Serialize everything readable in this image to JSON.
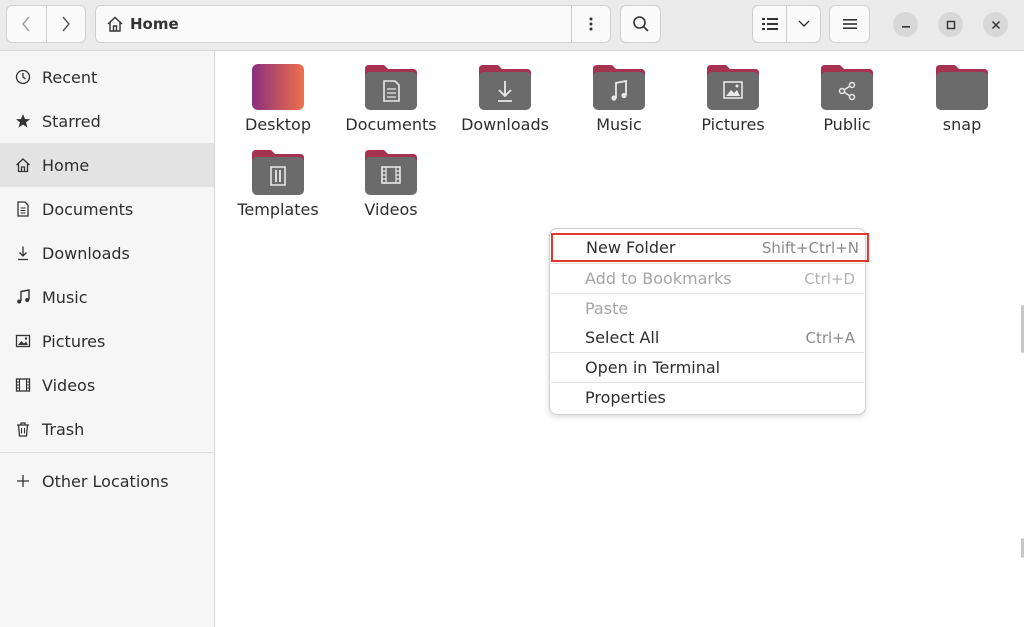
{
  "header": {
    "location": "Home"
  },
  "sidebar": {
    "items": [
      {
        "label": "Recent",
        "icon": "clock-icon"
      },
      {
        "label": "Starred",
        "icon": "star-icon"
      },
      {
        "label": "Home",
        "icon": "home-icon"
      },
      {
        "label": "Documents",
        "icon": "document-icon"
      },
      {
        "label": "Downloads",
        "icon": "download-icon"
      },
      {
        "label": "Music",
        "icon": "music-icon"
      },
      {
        "label": "Pictures",
        "icon": "picture-icon"
      },
      {
        "label": "Videos",
        "icon": "film-icon"
      },
      {
        "label": "Trash",
        "icon": "trash-icon"
      }
    ],
    "other": {
      "label": "Other Locations",
      "icon": "plus-icon"
    }
  },
  "files": [
    {
      "label": "Desktop",
      "icon": "desktop-folder-icon"
    },
    {
      "label": "Documents",
      "icon": "documents-folder-icon"
    },
    {
      "label": "Downloads",
      "icon": "downloads-folder-icon"
    },
    {
      "label": "Music",
      "icon": "music-folder-icon"
    },
    {
      "label": "Pictures",
      "icon": "pictures-folder-icon"
    },
    {
      "label": "Public",
      "icon": "public-folder-icon"
    },
    {
      "label": "snap",
      "icon": "folder-icon"
    },
    {
      "label": "Templates",
      "icon": "templates-folder-icon"
    },
    {
      "label": "Videos",
      "icon": "videos-folder-icon"
    }
  ],
  "context_menu": {
    "items": [
      {
        "label": "New Folder",
        "shortcut": "Shift+Ctrl+N",
        "enabled": true
      },
      {
        "label": "Add to Bookmarks",
        "shortcut": "Ctrl+D",
        "enabled": false
      },
      {
        "label": "Paste",
        "shortcut": "",
        "enabled": false
      },
      {
        "label": "Select All",
        "shortcut": "Ctrl+A",
        "enabled": true
      },
      {
        "label": "Open in Terminal",
        "shortcut": "",
        "enabled": true
      },
      {
        "label": "Properties",
        "shortcut": "",
        "enabled": true
      }
    ]
  },
  "colors": {
    "folder_top": "#a5324f",
    "folder_body": "#6b6b6b",
    "highlight": "#e03a2f"
  }
}
